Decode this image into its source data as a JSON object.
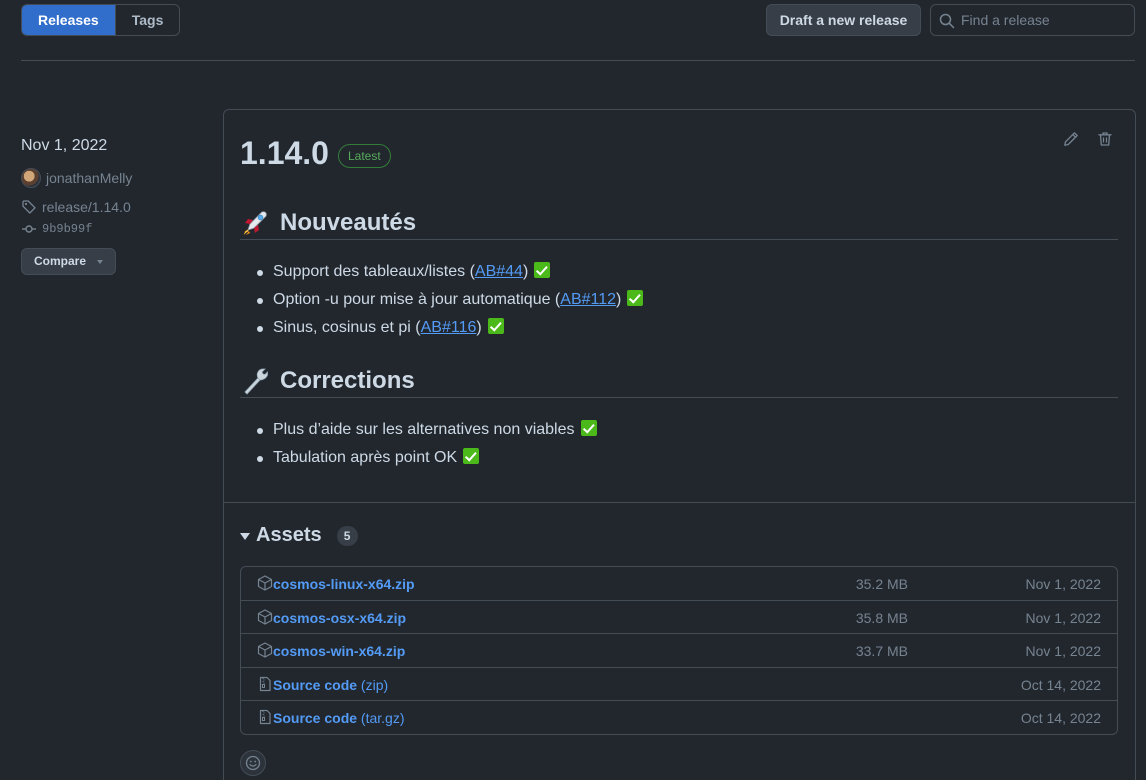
{
  "nav": {
    "tabs": [
      {
        "label": "Releases",
        "active": true
      },
      {
        "label": "Tags",
        "active": false
      }
    ],
    "draft_button": "Draft a new release",
    "search_placeholder": "Find a release"
  },
  "release_meta": {
    "date": "Nov 1, 2022",
    "author": "jonathanMelly",
    "tag": "release/1.14.0",
    "commit": "9b9b99f",
    "compare_label": "Compare"
  },
  "release": {
    "version": "1.14.0",
    "badge": "Latest",
    "sections": [
      {
        "emoji_icon": "rocket-icon",
        "title": "Nouveautés",
        "items": [
          {
            "text_before": "Support des tableaux/listes (",
            "link": "AB#44",
            "text_after": ")"
          },
          {
            "text_before": "Option -u pour mise à jour automatique (",
            "link": "AB#112",
            "text_after": ")"
          },
          {
            "text_before": "Sinus, cosinus et pi (",
            "link": "AB#116",
            "text_after": ")"
          }
        ]
      },
      {
        "emoji_icon": "wrench-icon",
        "title": "Corrections",
        "items": [
          {
            "text_before": "Plus d’aide sur les alternatives non viables",
            "link": "",
            "text_after": ""
          },
          {
            "text_before": "Tabulation après point OK",
            "link": "",
            "text_after": ""
          }
        ]
      }
    ]
  },
  "assets": {
    "title": "Assets",
    "count": "5",
    "rows": [
      {
        "icon": "package-icon",
        "name": "cosmos-linux-x64.zip",
        "suffix": "",
        "size": "35.2 MB",
        "date": "Nov 1, 2022"
      },
      {
        "icon": "package-icon",
        "name": "cosmos-osx-x64.zip",
        "suffix": "",
        "size": "35.8 MB",
        "date": "Nov 1, 2022"
      },
      {
        "icon": "package-icon",
        "name": "cosmos-win-x64.zip",
        "suffix": "",
        "size": "33.7 MB",
        "date": "Nov 1, 2022"
      },
      {
        "icon": "file-zip-icon",
        "name": "Source code",
        "suffix": " (zip)",
        "size": "",
        "date": "Oct 14, 2022"
      },
      {
        "icon": "file-zip-icon",
        "name": "Source code",
        "suffix": " (tar.gz)",
        "size": "",
        "date": "Oct 14, 2022"
      }
    ]
  },
  "colors": {
    "background": "#22272e",
    "accent": "#316dca",
    "link": "#539bf5",
    "latest_green": "#57ab5a",
    "check_green": "#4bb91a"
  }
}
